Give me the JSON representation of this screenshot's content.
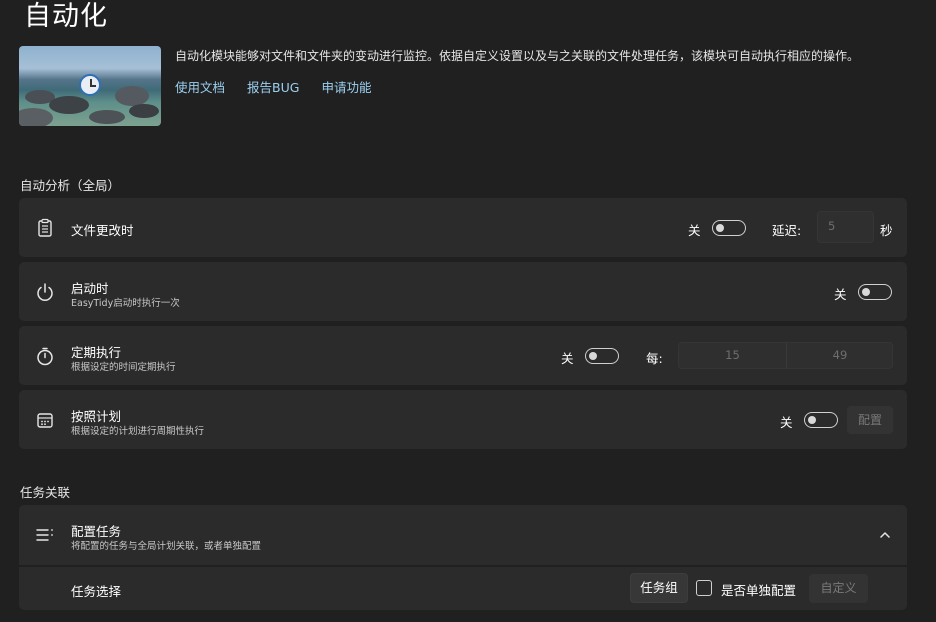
{
  "page": {
    "title": "自动化"
  },
  "hero": {
    "description": "自动化模块能够对文件和文件夹的变动进行监控。依据自定义设置以及与之关联的文件处理任务，该模块可自动执行相应的操作。",
    "links": [
      "使用文档",
      "报告BUG",
      "申请功能"
    ]
  },
  "auto_analysis": {
    "section_title": "自动分析（全局）",
    "file_change": {
      "label": "文件更改时",
      "toggle_state": "关",
      "delay_label": "延迟:",
      "delay_value": "5",
      "delay_unit": "秒",
      "icon": "clipboard-icon"
    },
    "on_startup": {
      "label": "启动时",
      "sub": "EasyTidy启动时执行一次",
      "toggle_state": "关",
      "icon": "power-icon"
    },
    "periodic": {
      "label": "定期执行",
      "sub": "根据设定的时间定期执行",
      "toggle_state": "关",
      "every_label": "每:",
      "value1": "15",
      "value2": "49",
      "icon": "stopwatch-icon"
    },
    "schedule": {
      "label": "按照计划",
      "sub": "根据设定的计划进行周期性执行",
      "toggle_state": "关",
      "config_label": "配置",
      "icon": "calendar-icon"
    }
  },
  "task_link": {
    "section_title": "任务关联",
    "config_task": {
      "label": "配置任务",
      "sub": "将配置的任务与全局计划关联，或者单独配置",
      "icon": "list-icon",
      "expand_icon": "chevron-up-icon"
    },
    "task_select": {
      "label": "任务选择",
      "group_button": "任务组",
      "checkbox_label": "是否单独配置",
      "custom_button": "自定义"
    }
  }
}
